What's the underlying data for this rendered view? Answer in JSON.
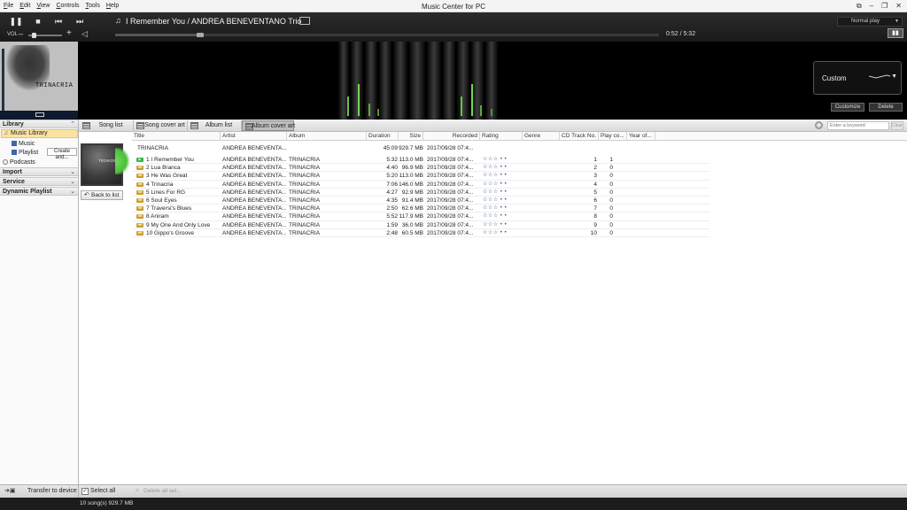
{
  "menu": {
    "items": [
      "File",
      "Edit",
      "View",
      "Controls",
      "Tools",
      "Help"
    ]
  },
  "window": {
    "title": "Music Center for PC",
    "controls": [
      "⧉",
      "–",
      "❐",
      "✕"
    ]
  },
  "player": {
    "pause_icon": "❚❚",
    "stop_icon": "■",
    "prev_icon": "⏮",
    "next_icon": "⏭",
    "now_playing": "I Remember You / ANDREA BENEVENTANO Trio",
    "play_mode": "Normal play",
    "volume_label": "VOL",
    "time": "0:52 / 5:32",
    "progress_fraction": 0.157,
    "volume_fraction": 0.15
  },
  "album_art": {
    "title": "TRINACRIA"
  },
  "equalizer": {
    "preset": "Custom",
    "customize_label": "Customize",
    "delete_label": "Delete"
  },
  "sidebar": {
    "library": "Library",
    "music_library": "Music Library",
    "music": "Music",
    "playlist": "Playlist",
    "create_label": "Create and...",
    "podcasts": "Podcasts",
    "import": "Import",
    "service": "Service",
    "dynamic_playlist": "Dynamic Playlist"
  },
  "view_tabs": [
    "Song list",
    "Song cover art",
    "Album list",
    "Album cover art"
  ],
  "search": {
    "placeholder": "Enter a keyword",
    "clear_label": "Clear"
  },
  "columns": [
    "Title",
    "Artist",
    "Album",
    "Duration",
    "Size",
    "Recorded",
    "Rating",
    "Genre",
    "CD Track No.",
    "Play co...",
    "Year of..."
  ],
  "album": {
    "title": "TRINACRIA",
    "artist": "ANDREA BENEVENTA...",
    "duration": "45:09",
    "size": "929.7 MB",
    "recorded": "2017/09/28 07:4..."
  },
  "back_label": "Back to list",
  "songs": [
    {
      "title": "1 I Remember You",
      "artist": "ANDREA BENEVENTA...",
      "album": "TRINACRIA",
      "duration": "5:32",
      "size": "113.0 MB",
      "recorded": "2017/09/28 07:4...",
      "rating": "☆☆☆ • •",
      "track": "1",
      "plays": "1",
      "playing": true
    },
    {
      "title": "2 Lua Branca",
      "artist": "ANDREA BENEVENTA...",
      "album": "TRINACRIA",
      "duration": "4:40",
      "size": "96.9 MB",
      "recorded": "2017/09/28 07:4...",
      "rating": "☆☆☆ • •",
      "track": "2",
      "plays": "0",
      "playing": false
    },
    {
      "title": "3 He Was Great",
      "artist": "ANDREA BENEVENTA...",
      "album": "TRINACRIA",
      "duration": "5:20",
      "size": "113.0 MB",
      "recorded": "2017/09/28 07:4...",
      "rating": "☆☆☆ • •",
      "track": "3",
      "plays": "0",
      "playing": false
    },
    {
      "title": "4 Trinacria",
      "artist": "ANDREA BENEVENTA...",
      "album": "TRINACRIA",
      "duration": "7:06",
      "size": "146.0 MB",
      "recorded": "2017/09/28 07:4...",
      "rating": "☆☆☆ • •",
      "track": "4",
      "plays": "0",
      "playing": false
    },
    {
      "title": "5 Lines For RG",
      "artist": "ANDREA BENEVENTA...",
      "album": "TRINACRIA",
      "duration": "4:27",
      "size": "92.9 MB",
      "recorded": "2017/09/28 07:4...",
      "rating": "☆☆☆ • •",
      "track": "5",
      "plays": "0",
      "playing": false
    },
    {
      "title": "6 Soul Eyes",
      "artist": "ANDREA BENEVENTA...",
      "album": "TRINACRIA",
      "duration": "4:35",
      "size": "91.4 MB",
      "recorded": "2017/09/28 07:4...",
      "rating": "☆☆☆ • •",
      "track": "6",
      "plays": "0",
      "playing": false
    },
    {
      "title": "7 Traversi's Blues",
      "artist": "ANDREA BENEVENTA...",
      "album": "TRINACRIA",
      "duration": "2:50",
      "size": "62.6 MB",
      "recorded": "2017/09/28 07:4...",
      "rating": "☆☆☆ • •",
      "track": "7",
      "plays": "0",
      "playing": false
    },
    {
      "title": "8 Aniram",
      "artist": "ANDREA BENEVENTA...",
      "album": "TRINACRIA",
      "duration": "5:52",
      "size": "117.9 MB",
      "recorded": "2017/09/28 07:4...",
      "rating": "☆☆☆ • •",
      "track": "8",
      "plays": "0",
      "playing": false
    },
    {
      "title": "9 My One And Only Love",
      "artist": "ANDREA BENEVENTA...",
      "album": "TRINACRIA",
      "duration": "1:59",
      "size": "36.0 MB",
      "recorded": "2017/09/28 07:4...",
      "rating": "☆☆☆ • •",
      "track": "9",
      "plays": "0",
      "playing": false
    },
    {
      "title": "10 Gippo's Groove",
      "artist": "ANDREA BENEVENTA...",
      "album": "TRINACRIA",
      "duration": "2:48",
      "size": "60.5 MB",
      "recorded": "2017/09/28 07:4...",
      "rating": "☆☆☆ • •",
      "track": "10",
      "plays": "0",
      "playing": false
    }
  ],
  "bottom": {
    "transfer_label": "Transfer to device",
    "select_all_label": "Select all",
    "delete_all_label": "Delete all sel..."
  },
  "status": {
    "text": "10 song(s) 929.7 MB"
  },
  "colors": {
    "accent_selected": "#fbe3a3",
    "playing_green": "#39b54a",
    "badge_gold": "#c89b2c",
    "star_blue": "#37547a"
  }
}
